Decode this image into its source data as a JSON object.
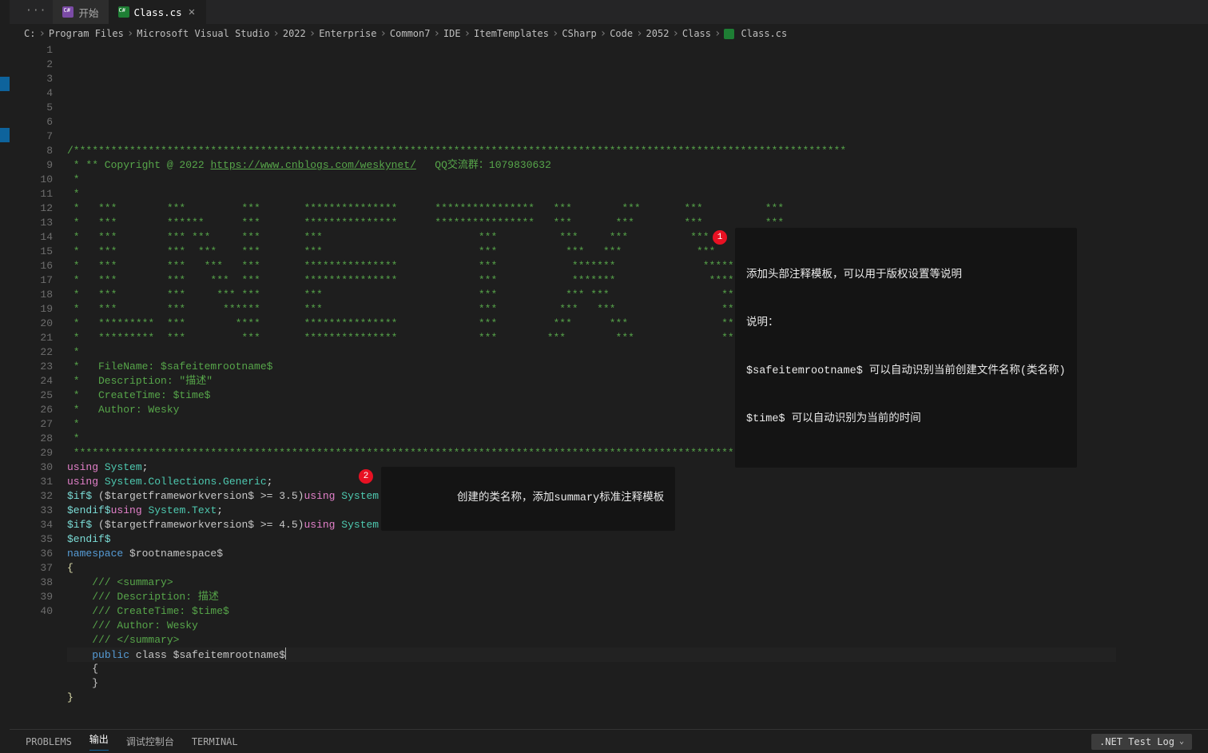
{
  "tabs": {
    "menu": "···",
    "start_label": "开始",
    "file_label": "Class.cs"
  },
  "breadcrumbs": [
    "C:",
    "Program Files",
    "Microsoft Visual Studio",
    "2022",
    "Enterprise",
    "Common7",
    "IDE",
    "ItemTemplates",
    "CSharp",
    "Code",
    "2052",
    "Class"
  ],
  "breadcrumb_file": "Class.cs",
  "panel": {
    "problems": "PROBLEMS",
    "output": "输出",
    "debug": "调试控制台",
    "terminal": "TERMINAL",
    "dropdown": ".NET Test Log"
  },
  "callouts": {
    "one_num": "1",
    "one_l1": "添加头部注释模板，可以用于版权设置等说明",
    "one_l2": "说明：",
    "one_l3": "$safeitemrootname$ 可以自动识别当前创建文件名称(类名称)",
    "one_l4": "$time$ 可以自动识别为当前的时间",
    "two_num": "2",
    "two_text": "创建的类名称，添加summary标准注释模板"
  },
  "code": {
    "l1": "/****************************************************************************************************************************",
    "l2a": " * ** Copyright @ 2022 ",
    "l2b": "https://www.cnblogs.com/weskynet/",
    "l2c": "   QQ交流群：1079830632",
    "l3": " *",
    "l4": " *",
    "l5": " *   ***        ***         ***       ***************      ****************   ***        ***       ***          ***",
    "l6": " *   ***        ******      ***       ***************      ****************   ***       ***        ***          ***",
    "l7": " *   ***        *** ***     ***       ***                         ***          ***     ***          ***        ***",
    "l8": " *   ***        ***  ***    ***       ***                         ***           ***   ***            ***      ***",
    "l9": " *   ***        ***   ***   ***       ***************             ***            *******              ********",
    "l10": " *   ***        ***    ***  ***       ***************             ***            *******               ******",
    "l11": " *   ***        ***     *** ***       ***                         ***           *** ***                  ***",
    "l12": " *   ***        ***      ******       ***                         ***          ***   ***                 ***",
    "l13": " *   *********  ***        ****       ***************             ***         ***      ***               ***",
    "l14": " *   *********  ***         ***       ***************             ***        ***        ***              ***",
    "l15": " *",
    "l16": " *   FileName: $safeitemrootname$",
    "l17": " *   Description: \"描述\"",
    "l18": " *   CreateTime: $time$",
    "l19": " *   Author: Wesky",
    "l20": " *",
    "l21": " *",
    "l22": " *****************************************************************************************************************************/",
    "l23_kw": "using",
    "l23_sp": " ",
    "l23_t": "System",
    "l23_e": ";",
    "l24_kw": "using",
    "l24_t": "System.Collections.Generic",
    "l24_e": ";",
    "l25_a": "$if$",
    "l25_b": " ($targetframeworkversion$ >= 3.5)",
    "l25_kw": "using",
    "l25_t": "System.Linq",
    "l25_e": ";",
    "l26_a": "$endif$",
    "l26_kw": "using",
    "l26_t": "System.Text",
    "l26_e": ";",
    "l27_a": "$if$",
    "l27_b": " ($targetframeworkversion$ >= 4.5)",
    "l27_kw": "using",
    "l27_t": "System.Threading.Tasks",
    "l27_e": ";",
    "l28": "$endif$",
    "l29_kw": "namespace",
    "l29_b": " $rootnamespace$",
    "l30": "{",
    "l31": "    /// <summary>",
    "l32": "    /// Description: 描述",
    "l33": "    /// CreateTime: $time$",
    "l34": "    /// Author: Wesky",
    "l35": "    /// </summary>",
    "l36_a": "    ",
    "l36_kw": "public",
    "l36_b": " class $safeitemrootname$",
    "l37": "    {",
    "l38": "    }",
    "l39": "}",
    "l40": ""
  }
}
